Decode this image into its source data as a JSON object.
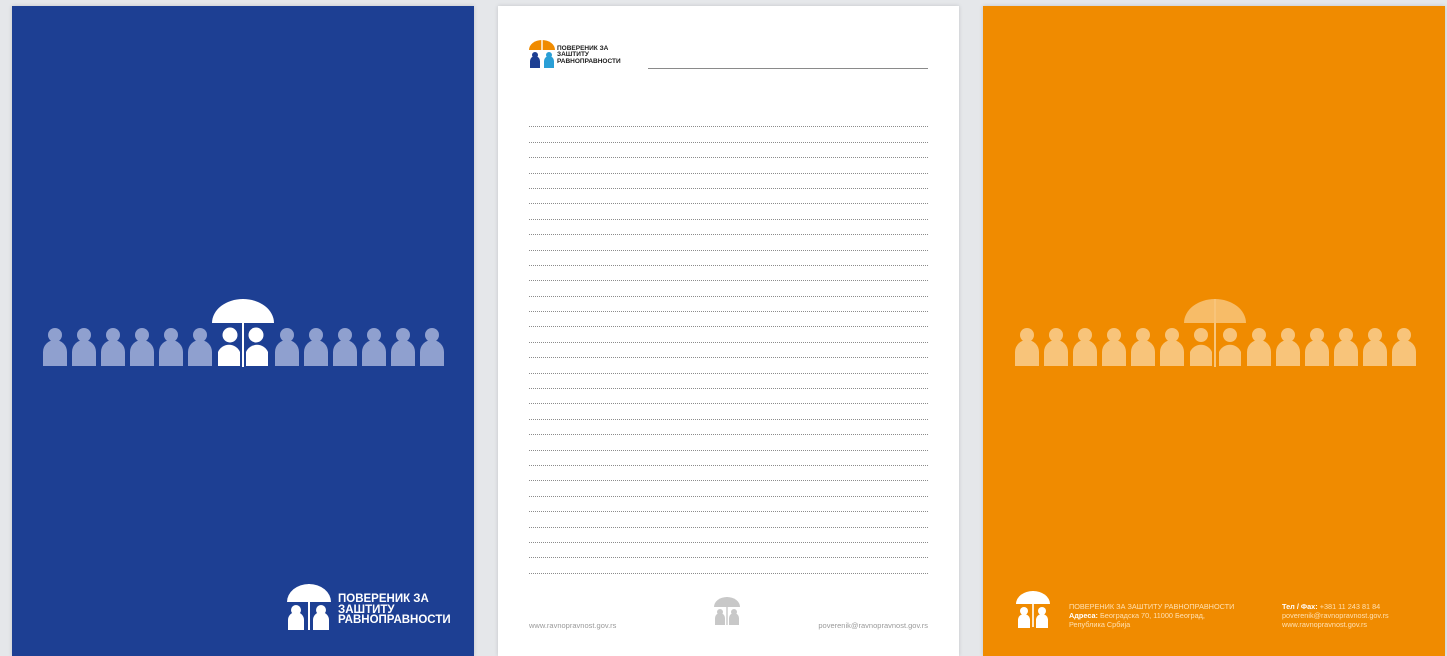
{
  "colors": {
    "blue": "#1d3f93",
    "orange": "#f08b00",
    "white": "#ffffff",
    "people_light_on_blue": "#8fa0cf",
    "people_light_on_orange": "#f8c47a"
  },
  "icons": {
    "logo": "umbrella-two-people-icon",
    "pattern": "people-row-icon"
  },
  "blue_page": {
    "logo_line1": "ПОВЕРЕНИК ЗА",
    "logo_line2": "ЗАШТИТУ",
    "logo_line3": "РАВНОПРАВНОСТИ"
  },
  "white_page": {
    "logo_line1": "ПОВЕРЕНИК ЗА",
    "logo_line2": "ЗАШТИТУ",
    "logo_line3": "РАВНОПРАВНОСТИ",
    "footer_website": "www.ravnopravnost.gov.rs",
    "footer_email": "poverenik@ravnopravnost.gov.rs"
  },
  "orange_page": {
    "org_name": "ПОВЕРЕНИК ЗА ЗАШТИТУ РАВНОПРАВНОСТИ",
    "address_label": "Адреса:",
    "address_value": "Београдска 70, 11000 Београд,",
    "country": "Република Србија",
    "phone_label": "Тел / Фах:",
    "phone_value": "+381 11 243 81 84",
    "email": "poverenik@ravnopravnost.gov.rs",
    "website": "www.ravnopravnost.gov.rs"
  }
}
